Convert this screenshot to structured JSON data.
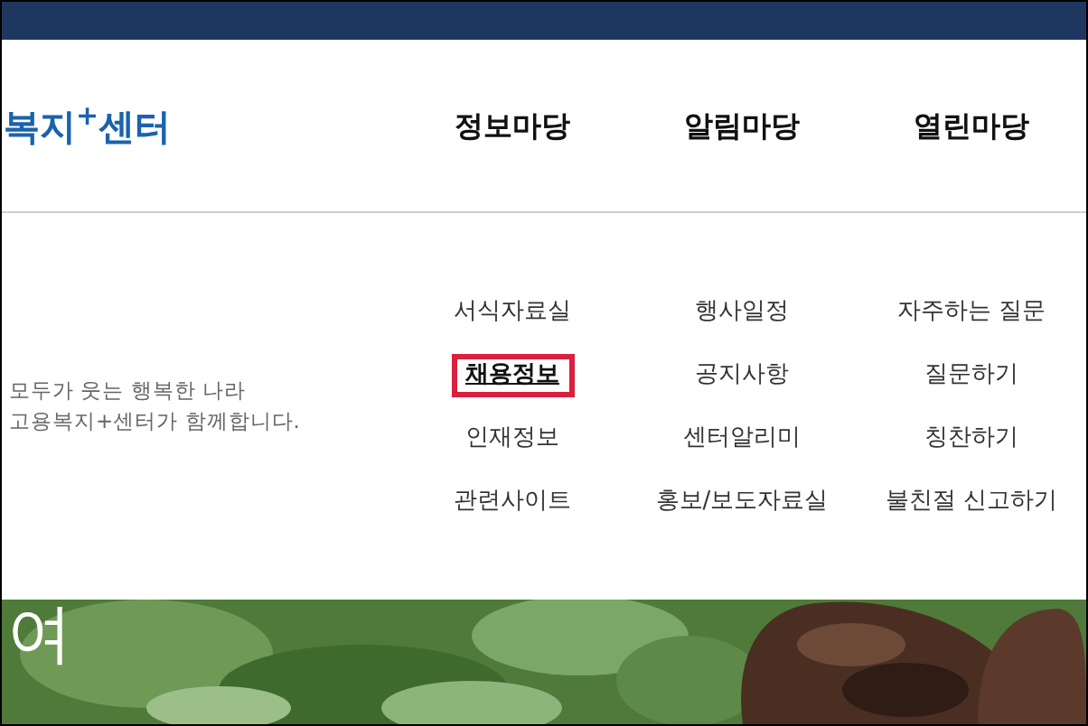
{
  "logo": "복지$^{+}$센터",
  "nav": [
    {
      "label": "정보마당"
    },
    {
      "label": "알림마당"
    },
    {
      "label": "열린마당"
    }
  ],
  "tagline": [
    "모두가 웃는 행복한 나라",
    "고용복지+센터가 함께합니다."
  ],
  "menu_columns": [
    {
      "items": [
        {
          "label": "서식자료실",
          "selected": false
        },
        {
          "label": "채용정보",
          "selected": true
        },
        {
          "label": "인재정보",
          "selected": false
        },
        {
          "label": "관련사이트",
          "selected": false
        }
      ]
    },
    {
      "items": [
        {
          "label": "행사일정",
          "selected": false
        },
        {
          "label": "공지사항",
          "selected": false
        },
        {
          "label": "센터알리미",
          "selected": false
        },
        {
          "label": "홍보/보도자료실",
          "selected": false
        }
      ]
    },
    {
      "items": [
        {
          "label": "자주하는 질문",
          "selected": false
        },
        {
          "label": "질문하기",
          "selected": false
        },
        {
          "label": "칭찬하기",
          "selected": false
        },
        {
          "label": "불친절 신고하기",
          "selected": false
        }
      ]
    }
  ],
  "banner": {
    "kind": "picture",
    "heading": "여"
  }
}
